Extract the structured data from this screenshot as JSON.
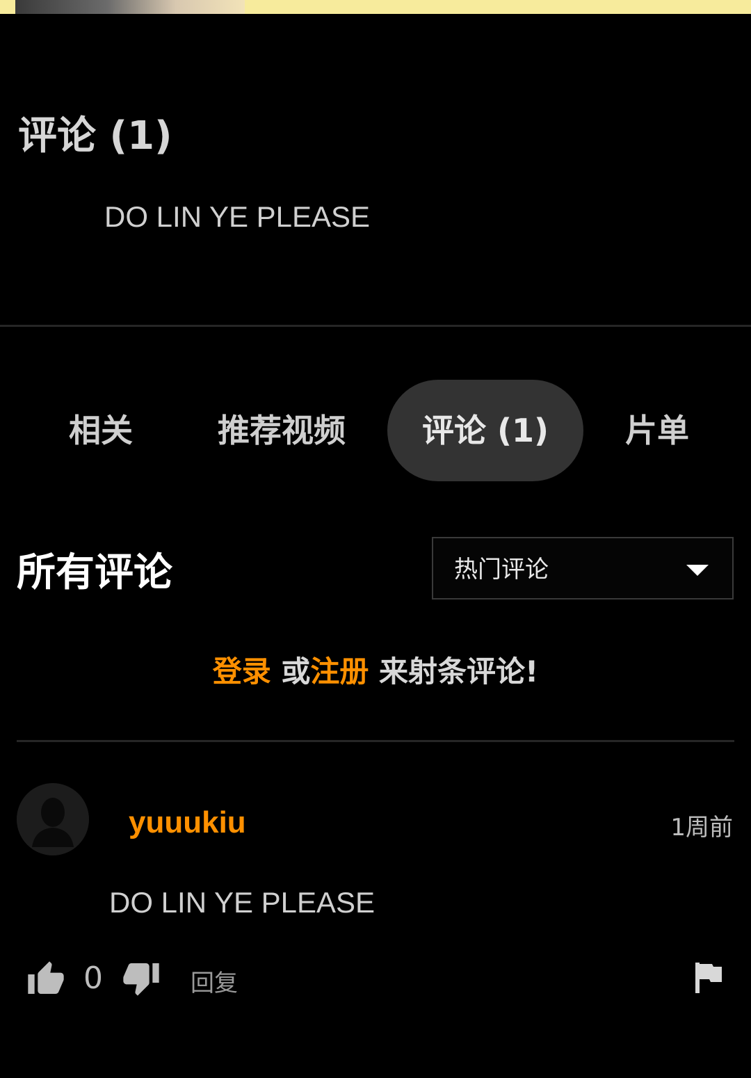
{
  "header": {
    "comments_title": "评论 (1)",
    "featured_comment": "DO LIN YE PLEASE"
  },
  "tabs": [
    {
      "label": "相关",
      "active": false
    },
    {
      "label": "推荐视频",
      "active": false
    },
    {
      "label": "评论 (1)",
      "active": true
    },
    {
      "label": "片单",
      "active": false
    }
  ],
  "comments_section": {
    "title": "所有评论",
    "sort": {
      "selected": "热门评论"
    },
    "login_prompt": {
      "login": "登录",
      "or": " 或",
      "register": "注册",
      "rest": " 来射条评论!"
    }
  },
  "comment": {
    "username": "yuuukiu",
    "time": "1周前",
    "text": "DO LIN YE PLEASE",
    "likes": "0",
    "reply_label": "回复"
  },
  "colors": {
    "accent": "#ff9000",
    "background": "#000000",
    "active_tab": "#333333"
  },
  "icons": {
    "like": "thumbs-up-icon",
    "dislike": "thumbs-down-icon",
    "flag": "flag-icon",
    "dropdown": "chevron-down-icon",
    "avatar": "default-avatar-icon"
  }
}
